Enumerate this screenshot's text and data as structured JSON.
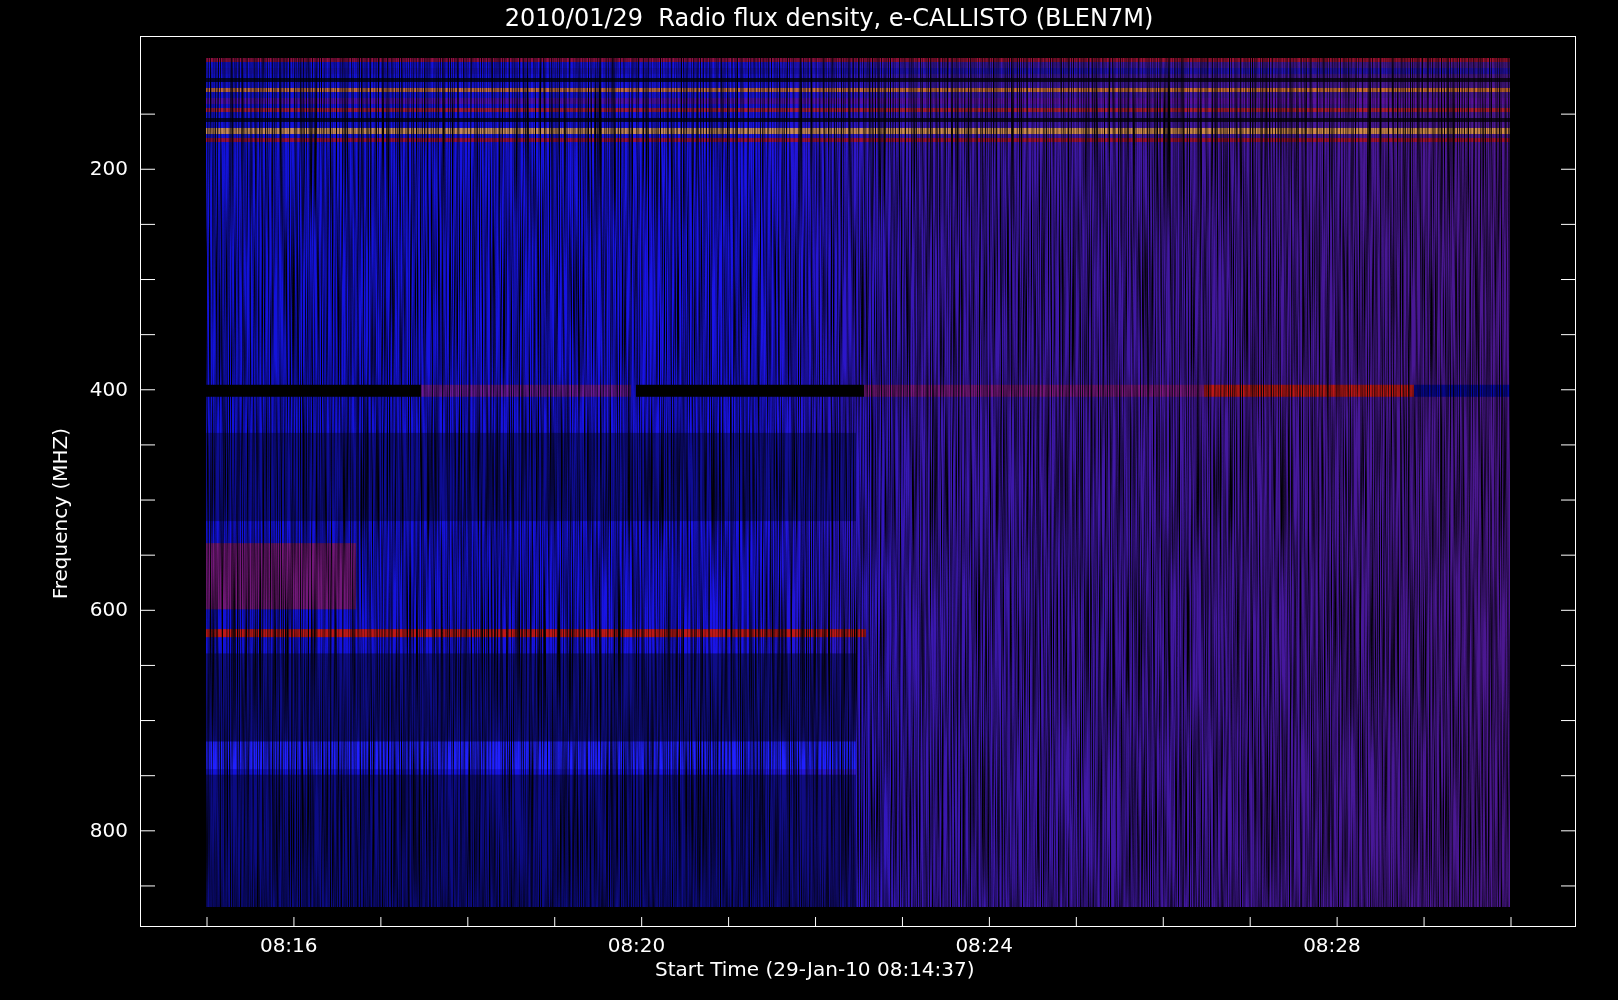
{
  "plot": {
    "title": "2010/01/29  Radio flux density, e-CALLISTO (BLEN7M)",
    "y_label": "Frequency (MHZ)",
    "y_tick_labels": [
      "200",
      "400",
      "600",
      "800"
    ],
    "x_tick_labels": [
      "08:16",
      "08:20",
      "08:24",
      "08:28"
    ],
    "x_label": "Start Time (29-Jan-10 08:14:37)"
  }
}
